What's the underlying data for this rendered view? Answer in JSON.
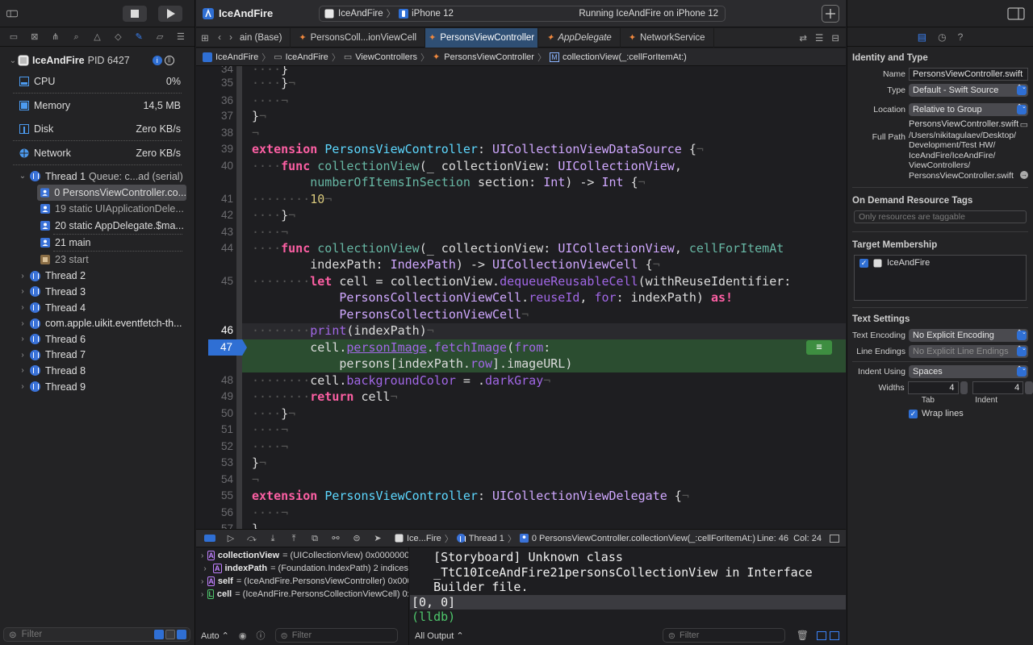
{
  "toolbar": {
    "project_title": "IceAndFire",
    "scheme_name": "IceAndFire",
    "destination": "iPhone 12",
    "status": "Running IceAndFire on iPhone 12"
  },
  "navigator": {
    "process": {
      "name": "IceAndFire",
      "pid": "PID 6427"
    },
    "gauges": [
      {
        "label": "CPU",
        "value": "0%"
      },
      {
        "label": "Memory",
        "value": "14,5 MB"
      },
      {
        "label": "Disk",
        "value": "Zero KB/s"
      },
      {
        "label": "Network",
        "value": "Zero KB/s"
      }
    ],
    "thread1": "Thread 1",
    "thread1_queue": "Queue: c...ad (serial)",
    "frames": [
      "0 PersonsViewController.co...",
      "19 static UIApplicationDele...",
      "20 static AppDelegate.$ma...",
      "21 main",
      "23 start"
    ],
    "threads": [
      "Thread 2",
      "Thread 3",
      "Thread 4",
      "com.apple.uikit.eventfetch-th...",
      "Thread 6",
      "Thread 7",
      "Thread 8",
      "Thread 9"
    ],
    "filter_placeholder": "Filter"
  },
  "tabs": [
    {
      "label": "ain (Base)",
      "swift": false
    },
    {
      "label": "PersonsColl...ionViewCell",
      "swift": true
    },
    {
      "label": "PersonsViewController",
      "swift": true
    },
    {
      "label": "AppDelegate",
      "swift": true
    },
    {
      "label": "NetworkService",
      "swift": true
    }
  ],
  "jumpbar": [
    "IceAndFire",
    "IceAndFire",
    "ViewControllers",
    "PersonsViewController",
    "collectionView(_:cellForItemAt:)"
  ],
  "code": {
    "line_numbers": [
      "34",
      "35",
      "36",
      "37",
      "38",
      "39",
      "40",
      "",
      "41",
      "42",
      "43",
      "44",
      "",
      "45",
      "",
      "",
      "46",
      "47",
      "",
      "48",
      "49",
      "50",
      "51",
      "52",
      "53",
      "54",
      "55",
      "56",
      "57"
    ],
    "current_line": "47",
    "l39": {
      "kw": "extension",
      "type": "PersonsViewController",
      "proto": "UICollectionViewDataSource",
      "rest": " {"
    },
    "l40a": {
      "kw": "func",
      "fn": "collectionView",
      "p1": "(_ collectionView: ",
      "type": "UICollectionView",
      "rest": ","
    },
    "l40b": {
      "label": "numberOfItemsInSection",
      "p": " section: ",
      "type1": "Int",
      "arrow": ") -> ",
      "type2": "Int",
      "rest": " {"
    },
    "l41": "10",
    "l44a": {
      "kw": "func",
      "fn": "collectionView",
      "p1": "(_ collectionView: ",
      "type": "UICollectionView",
      "comma": ", ",
      "label": "cellForItemAt"
    },
    "l44b": {
      "p": "indexPath: ",
      "type1": "IndexPath",
      "arrow": ") -> ",
      "type2": "UICollectionViewCell",
      "rest": " {"
    },
    "l45a": {
      "kw": "let",
      "p1": " cell = collectionView.",
      "fn": "dequeueReusableCell",
      "p2": "(withReuseIdentifier:"
    },
    "l45b": {
      "type": "PersonsCollectionViewCell",
      "p1": ".",
      "prop": "reuseId",
      "p2": ", ",
      "label": "for",
      "p3": ": indexPath) ",
      "kw": "as!"
    },
    "l45c": "PersonsCollectionViewCell",
    "l46": {
      "fn": "print",
      "rest": "(indexPath)"
    },
    "l47a": {
      "p1": "cell.",
      "prop": "personImage",
      "p2": ".",
      "fn": "fetchImage",
      "p3": "(",
      "label": "from",
      "p4": ":"
    },
    "l47b": {
      "p1": "persons[indexPath.",
      "prop": "row",
      "p2": "].imageURL)"
    },
    "l48": {
      "p1": "cell.",
      "prop": "backgroundColor",
      "p2": " = .",
      "val": "darkGray"
    },
    "l49": {
      "kw": "return",
      "rest": " cell"
    },
    "l55": {
      "kw": "extension",
      "type": "PersonsViewController",
      "proto": "UICollectionViewDelegate",
      "rest": " {"
    }
  },
  "debugbar": {
    "crumb1": "Ice...Fire",
    "crumb2": "Thread 1",
    "crumb3": "0 PersonsViewController.collectionView(_:cellForItemAt:)",
    "position": "Line: 46  Col: 24"
  },
  "variables": [
    {
      "badge": "A",
      "name": "collectionView",
      "value": "= (UICollectionView) 0x0000000..."
    },
    {
      "badge": "A",
      "name": "indexPath",
      "value": "= (Foundation.IndexPath) 2 indices"
    },
    {
      "badge": "A",
      "name": "self",
      "value": "= (IceAndFire.PersonsViewController) 0x0000..."
    },
    {
      "badge": "L",
      "name": "cell",
      "value": "= (IceAndFire.PersonsCollectionViewCell) 0x0..."
    }
  ],
  "var_footer": {
    "mode": "Auto ⌃",
    "filter": "Filter"
  },
  "console": {
    "lines": [
      "   [Storyboard] Unknown class",
      "   _TtC10IceAndFire21personsCollectionView in Interface",
      "   Builder file.",
      "[0, 0]",
      "(lldb)"
    ],
    "output_mode": "All Output ⌃",
    "filter": "Filter"
  },
  "inspector": {
    "identity_title": "Identity and Type",
    "name_label": "Name",
    "name_value": "PersonsViewController.swift",
    "type_label": "Type",
    "type_value": "Default - Swift Source",
    "location_label": "Location",
    "location_value": "Relative to Group",
    "location_file": "PersonsViewController.swift",
    "fullpath_label": "Full Path",
    "fullpath_lines": [
      "/Users/nikitagulaev/Desktop/",
      "Development/Test HW/",
      "IceAndFire/IceAndFire/",
      "ViewControllers/",
      "PersonsViewController.swift"
    ],
    "odr_title": "On Demand Resource Tags",
    "odr_placeholder": "Only resources are taggable",
    "target_title": "Target Membership",
    "target_name": "IceAndFire",
    "text_title": "Text Settings",
    "encoding_label": "Text Encoding",
    "encoding_value": "No Explicit Encoding",
    "endings_label": "Line Endings",
    "endings_value": "No Explicit Line Endings",
    "indent_label": "Indent Using",
    "indent_value": "Spaces",
    "widths_label": "Widths",
    "tab_value": "4",
    "indent_width_value": "4",
    "tab_label": "Tab",
    "indent_sub_label": "Indent",
    "wrap_label": "Wrap lines"
  }
}
